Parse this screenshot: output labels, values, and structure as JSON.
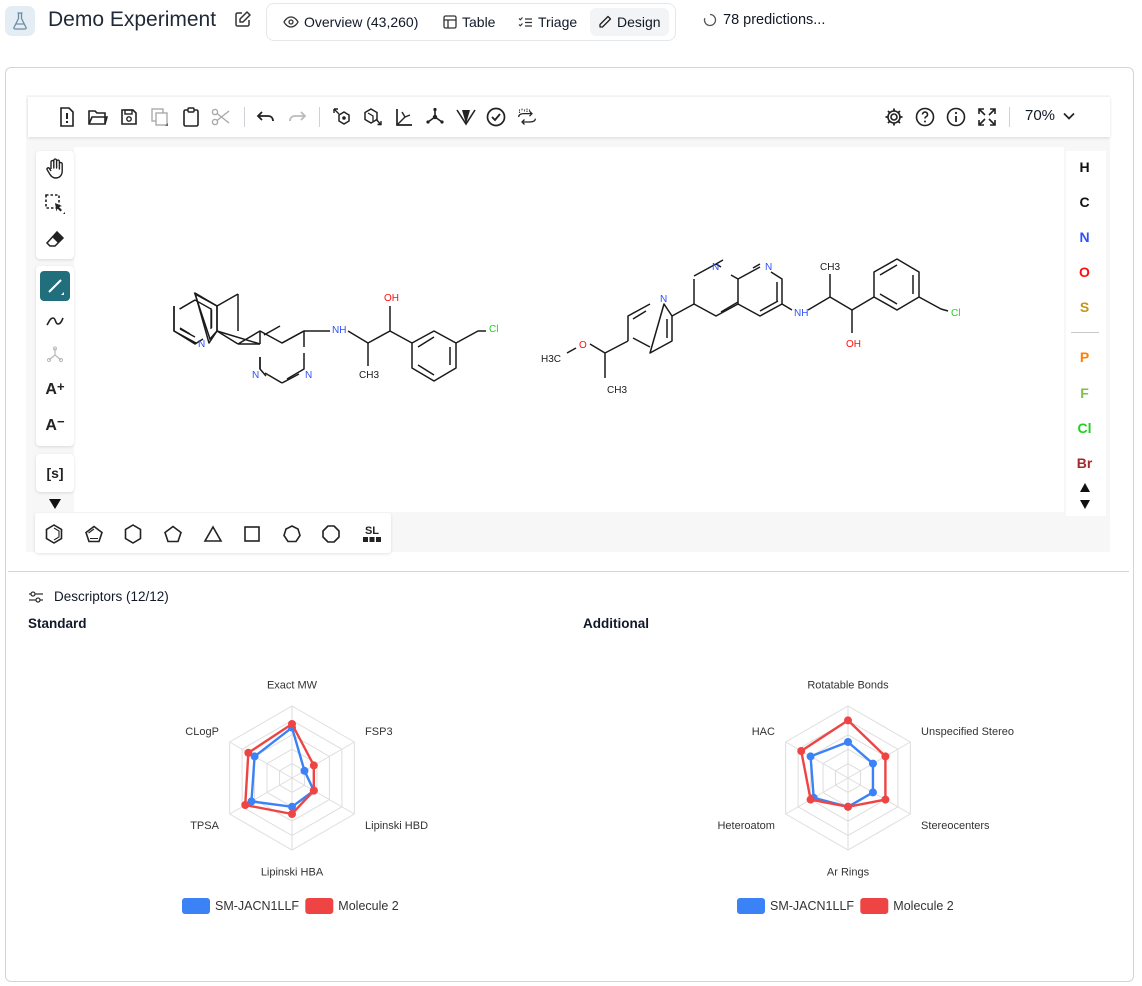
{
  "header": {
    "title": "Demo Experiment",
    "tabs": [
      {
        "label": "Overview (43,260)",
        "icon": "eye-icon"
      },
      {
        "label": "Table",
        "icon": "table-icon"
      },
      {
        "label": "Triage",
        "icon": "checklist-icon"
      },
      {
        "label": "Design",
        "icon": "pencil-icon",
        "active": true
      }
    ],
    "predictions": "78 predictions..."
  },
  "toolbar": {
    "zoom": "70%",
    "icons": [
      "new-document-icon",
      "open-folder-icon",
      "save-icon",
      "copy-icon",
      "paste-icon",
      "cut-icon",
      "undo-icon",
      "redo-icon",
      "layout-icon",
      "clean-icon",
      "3d-axes-icon",
      "hydrogens-icon",
      "cip-stereo-icon",
      "check-icon",
      "analyse-icon",
      "settings-icon",
      "help-icon",
      "info-icon",
      "fullscreen-icon"
    ]
  },
  "left_tools": {
    "font_increase": "A",
    "font_decrease": "A",
    "sgroup": "[s]",
    "icons": [
      "hand-icon",
      "select-icon",
      "eraser-icon",
      "single-bond-icon",
      "chain-icon",
      "fragment-icon",
      "font-increase-icon",
      "font-decrease-icon",
      "sgroup-icon",
      "more-arrow-icon"
    ]
  },
  "atoms": [
    {
      "symbol": "H",
      "color": "#111111"
    },
    {
      "symbol": "C",
      "color": "#111111"
    },
    {
      "symbol": "N",
      "color": "#3050f8"
    },
    {
      "symbol": "O",
      "color": "#ff0d0d"
    },
    {
      "symbol": "S",
      "color": "#c59418"
    },
    {
      "symbol": "P",
      "color": "#ff8000"
    },
    {
      "symbol": "F",
      "color": "#7dc246"
    },
    {
      "symbol": "Cl",
      "color": "#1fd01f"
    },
    {
      "symbol": "Br",
      "color": "#a62929"
    }
  ],
  "shapes": {
    "sl_label": "SL",
    "icons": [
      "benzene-icon",
      "cyclopentadiene-icon",
      "cyclohexane-icon",
      "cyclopentane-icon",
      "cyclopropane-icon",
      "cyclobutane-icon",
      "cycloheptane-icon",
      "cyclooctane-icon",
      "sl-templates-icon"
    ]
  },
  "molecules": {
    "mol1": {
      "n1": "N",
      "n2": "N",
      "n3": "N",
      "nh": "NH",
      "oh": "OH",
      "ch3": "CH3",
      "cl": "Cl"
    },
    "mol2": {
      "n1": "N",
      "n2": "N",
      "n3": "N",
      "nh": "NH",
      "oh": "OH",
      "ch3a": "CH3",
      "ch3b": "CH3",
      "ch3c": "H3C",
      "o": "O",
      "cl": "Cl"
    }
  },
  "descriptors": {
    "title": "Descriptors (12/12)",
    "standard_label": "Standard",
    "additional_label": "Additional"
  },
  "colors": {
    "series1": "#3b82f6",
    "series2": "#ef4444",
    "accent": "#216f7c"
  },
  "chart_data": [
    {
      "type": "radar",
      "title": "Standard",
      "axes": [
        "Exact MW",
        "FSP3",
        "Lipinski HBD",
        "Lipinski HBA",
        "TPSA",
        "CLogP"
      ],
      "range": [
        0,
        1
      ],
      "grid": true,
      "legend_position": "bottom",
      "series": [
        {
          "name": "SM-JACN1LLF",
          "values": [
            0.7,
            0.2,
            0.35,
            0.4,
            0.65,
            0.6
          ],
          "color": "#3b82f6"
        },
        {
          "name": "Molecule 2",
          "values": [
            0.75,
            0.35,
            0.35,
            0.5,
            0.75,
            0.7
          ],
          "color": "#ef4444"
        }
      ]
    },
    {
      "type": "radar",
      "title": "Additional",
      "axes": [
        "Rotatable Bonds",
        "Unspecified Stereo",
        "Stereocenters",
        "Ar Rings",
        "Heteroatom",
        "HAC"
      ],
      "range": [
        0,
        1
      ],
      "grid": true,
      "legend_position": "bottom",
      "series": [
        {
          "name": "SM-JACN1LLF",
          "values": [
            0.5,
            0.4,
            0.4,
            0.4,
            0.55,
            0.6
          ],
          "color": "#3b82f6"
        },
        {
          "name": "Molecule 2",
          "values": [
            0.8,
            0.6,
            0.6,
            0.4,
            0.6,
            0.75
          ],
          "color": "#ef4444"
        }
      ]
    }
  ]
}
